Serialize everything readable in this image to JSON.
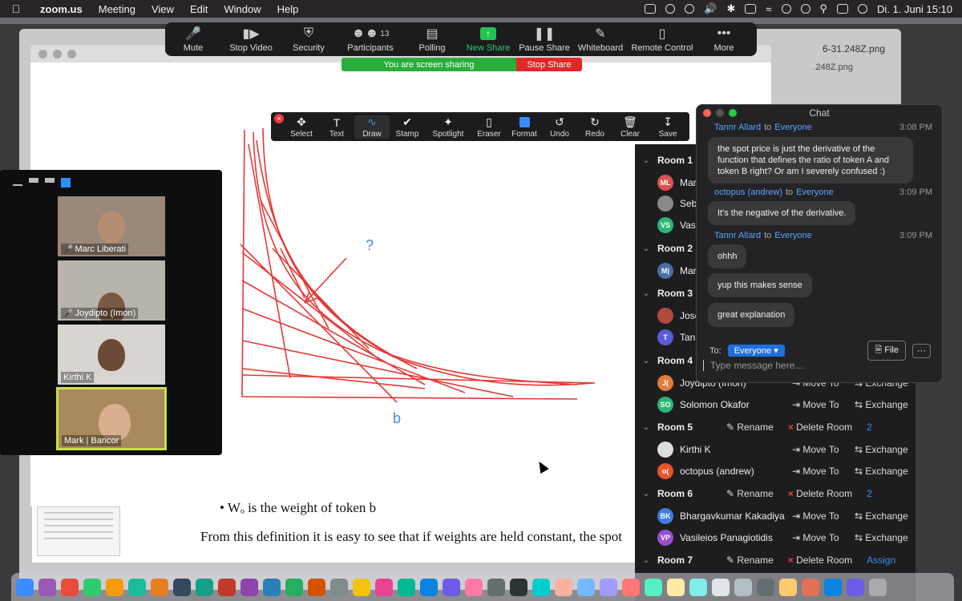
{
  "menubar": {
    "app": "zoom.us",
    "items": [
      "Meeting",
      "View",
      "Edit",
      "Window",
      "Help"
    ],
    "clock": "Di. 1. Juni  15:10"
  },
  "background": {
    "file_label": "6-31.248Z.png",
    "file_label2": ".248Z.png"
  },
  "zoom_toolbar": {
    "items": [
      {
        "label": "Mute",
        "icon": "mic-icon"
      },
      {
        "label": "Stop Video",
        "icon": "video-icon"
      },
      {
        "label": "Security",
        "icon": "shield-icon"
      },
      {
        "label": "Participants",
        "icon": "participants-icon",
        "badge": "13"
      },
      {
        "label": "Polling",
        "icon": "polling-icon"
      },
      {
        "label": "New Share",
        "icon": "share-icon"
      },
      {
        "label": "Pause Share",
        "icon": "pause-icon"
      },
      {
        "label": "Whiteboard",
        "icon": "pen-icon"
      },
      {
        "label": "Remote Control",
        "icon": "mouse-icon"
      },
      {
        "label": "More",
        "icon": "more-icon"
      }
    ],
    "sharing_text": "You are screen sharing",
    "stop_share": "Stop Share"
  },
  "annotation_toolbar": {
    "items": [
      "Select",
      "Text",
      "Draw",
      "Stamp",
      "Spotlight",
      "Eraser",
      "Format",
      "Undo",
      "Redo",
      "Clear",
      "Save"
    ],
    "active": "Draw"
  },
  "drawing": {
    "label_q": "?",
    "label_b": "b"
  },
  "pdf": {
    "bullet": "• Wₒ is the weight of token b",
    "para": "From this definition it is easy to see that if weights are held constant, the spot"
  },
  "gallery": {
    "tiles": [
      {
        "name": "Marc Liberati",
        "muted": true
      },
      {
        "name": "Joydipto (Imon)",
        "muted": true
      },
      {
        "name": "Kirthi K",
        "muted": false
      },
      {
        "name": "Mark | Bancor",
        "muted": false,
        "active": true
      }
    ]
  },
  "breakout": {
    "rooms": [
      {
        "name": "Room 1",
        "participants": [
          {
            "initials": "ML",
            "name": "Mar",
            "color": "#d9534f"
          },
          {
            "initials": "",
            "name": "Seb",
            "color": "#888888"
          },
          {
            "initials": "VS",
            "name": "Vas",
            "color": "#2bb673"
          }
        ]
      },
      {
        "name": "Room 2",
        "participants": [
          {
            "initials": "M|",
            "name": "Mar",
            "color": "#4a6fa5"
          }
        ]
      },
      {
        "name": "Room 3",
        "participants": [
          {
            "initials": "",
            "name": "Jose",
            "color": "#b04a3a"
          },
          {
            "initials": "T",
            "name": "Tanr",
            "color": "#5b5bd6"
          }
        ]
      },
      {
        "name": "Room 4",
        "participants": [
          {
            "initials": "J(",
            "name": "Joydipto (Imon)",
            "color": "#e07b39"
          },
          {
            "initials": "SO",
            "name": "Solomon Okafor",
            "color": "#2bb673"
          }
        ]
      },
      {
        "name": "Room 5",
        "rename": "Rename",
        "delete": "Delete Room",
        "count": "2",
        "participants": [
          {
            "initials": "",
            "name": "Kirthi K",
            "color": "#dddddd"
          },
          {
            "initials": "o(",
            "name": "octopus (andrew)",
            "color": "#e8542d"
          }
        ]
      },
      {
        "name": "Room 6",
        "rename": "Rename",
        "delete": "Delete Room",
        "count": "2",
        "participants": [
          {
            "initials": "BK",
            "name": "Bhargavkumar Kakadiya",
            "color": "#3d7de0"
          },
          {
            "initials": "VP",
            "name": "Vasileios Panagiotidis",
            "color": "#9b4fd0"
          }
        ]
      },
      {
        "name": "Room 7",
        "rename": "Rename",
        "delete": "Delete Room",
        "count": "Assign",
        "participants": []
      }
    ],
    "move_to": "Move To",
    "exchange": "Exchange"
  },
  "chat": {
    "title": "Chat",
    "messages": [
      {
        "from": "Tannr Allard",
        "to": "Everyone",
        "time": "3:08 PM",
        "texts": [
          "the spot price is just the derivative of the function that defines the ratio of token A and token B right? Or am I severely confused :)"
        ]
      },
      {
        "from": "octopus (andrew)",
        "to": "Everyone",
        "time": "3:09 PM",
        "texts": [
          "It's the negative of the derivative."
        ]
      },
      {
        "from": "Tannr Allard",
        "to": "Everyone",
        "time": "3:09 PM",
        "texts": [
          "ohhh",
          "yup this makes sense",
          "great explanation"
        ]
      }
    ],
    "to_label": "To:",
    "to_value": "Everyone",
    "file_button": "File",
    "more_button": "···",
    "placeholder": "Type message here..."
  },
  "dock": {
    "colors": [
      "#3b8cff",
      "#9b59b6",
      "#e74c3c",
      "#2ecc71",
      "#f39c12",
      "#1abc9c",
      "#e67e22",
      "#34495e",
      "#16a085",
      "#c0392b",
      "#8e44ad",
      "#2980b9",
      "#27ae60",
      "#d35400",
      "#7f8c8d",
      "#f1c40f",
      "#e84393",
      "#00b894",
      "#0984e3",
      "#6c5ce7",
      "#fd79a8",
      "#636e72",
      "#2d3436",
      "#00cec9",
      "#fab1a0",
      "#74b9ff",
      "#a29bfe",
      "#ff7675",
      "#55efc4",
      "#ffeaa7",
      "#81ecec",
      "#dfe6e9",
      "#b2bec3",
      "#636e72",
      "#fdcb6e",
      "#e17055",
      "#0984e3",
      "#6c5ce7",
      "#aaaaaa"
    ]
  }
}
